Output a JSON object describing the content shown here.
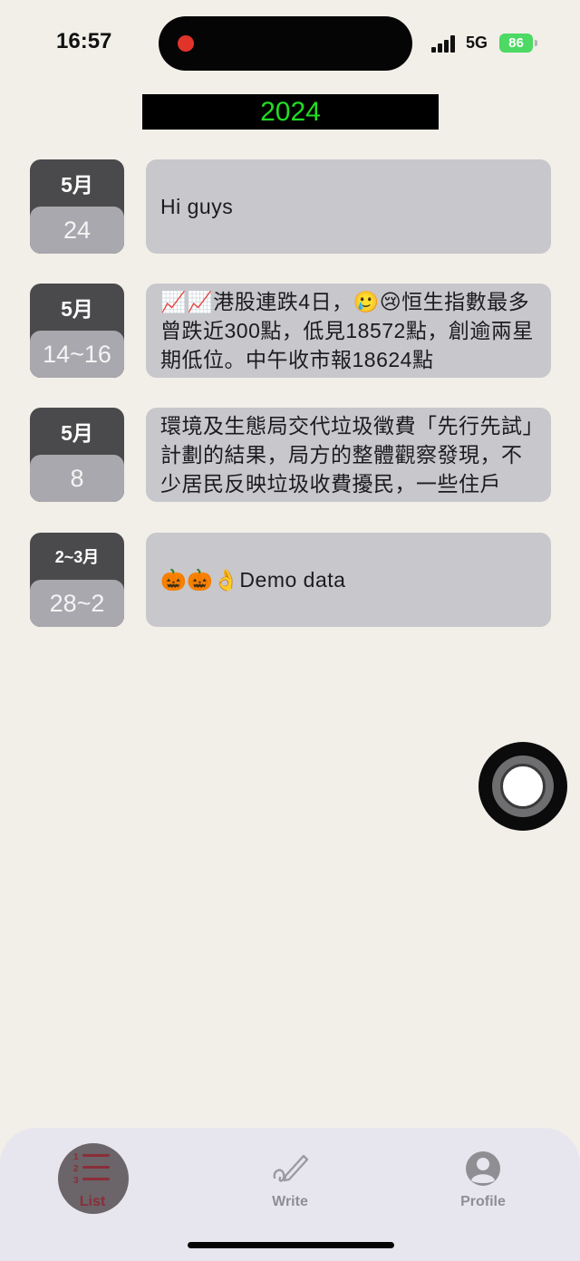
{
  "status_bar": {
    "time": "16:57",
    "network": "5G",
    "battery": "86"
  },
  "year": "2024",
  "entries": [
    {
      "month": "5月",
      "day": "24",
      "text": "Hi guys"
    },
    {
      "month": "5月",
      "day": "14~16",
      "text": "📈📈港股連跌4日，🥲😢恒生指數最多曾跌近300點，低見18572點，創逾兩星期低位。中午收市報18624點"
    },
    {
      "month": "5月",
      "day": "8",
      "text": "環境及生態局交代垃圾徵費「先行先試」計劃的結果，局方的整體觀察發現，不少居民反映垃圾收費擾民，一些住戶"
    },
    {
      "month": "2~3月",
      "day": "28~2",
      "text": "🎃🎃👌Demo data"
    }
  ],
  "tabs": [
    {
      "label": "List",
      "icon": "list-icon",
      "active": true
    },
    {
      "label": "Write",
      "icon": "pen-icon",
      "active": false
    },
    {
      "label": "Profile",
      "icon": "person-icon",
      "active": false
    }
  ],
  "colors": {
    "background": "#f1efe8",
    "year_text": "#22dd22",
    "active_tab": "#8a2e3a"
  }
}
